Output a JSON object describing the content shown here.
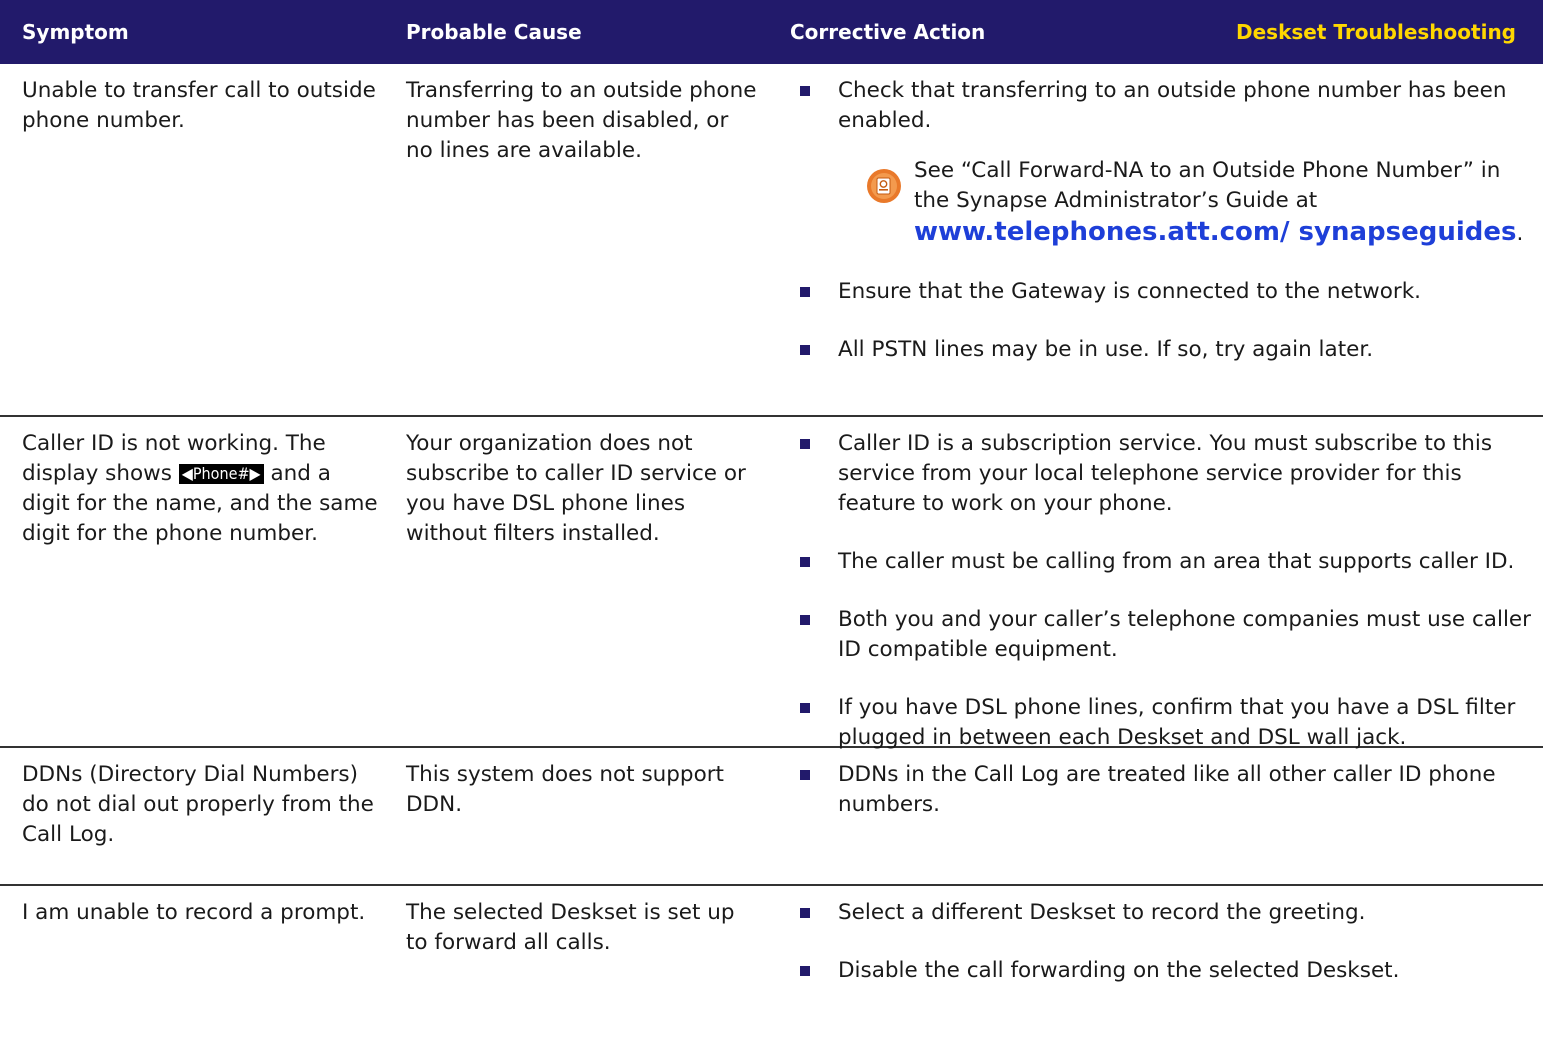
{
  "header": {
    "symptom": "Symptom",
    "cause": "Probable Cause",
    "action": "Corrective Action",
    "section_title": "Deskset Troubleshooting"
  },
  "rows": [
    {
      "symptom": "Unable to transfer call to outside phone number.",
      "cause": "Transferring to an outside phone number has been disabled, or no lines are available.",
      "actions": [
        "Check that transferring to an outside phone number has been enabled.",
        "Ensure that the Gateway is connected to the network.",
        "All PSTN lines may be in use. If so, try again later."
      ],
      "note": {
        "text": "See “Call Forward-NA to an Outside Phone Number” in the Synapse Administrator’s Guide at",
        "link": "www.telephones.att.com/ synapseguides",
        "end": "."
      }
    },
    {
      "symptom_before": "Caller ID is not working. The display shows",
      "softkey": "◀Phone#▶",
      "symptom_after": "and a digit for the name, and the same digit for the phone number.",
      "cause": "Your organization does not subscribe to caller ID service or you have DSL phone lines without filters installed.",
      "actions": [
        "Caller ID is a subscription service. You must subscribe to this service from your local telephone service provider for this feature to work on your phone.",
        "The caller must be calling from an area that supports caller ID.",
        "Both you and your caller’s telephone companies must use caller ID compatible equipment.",
        "If you have DSL phone lines, confirm that you have a DSL filter plugged in between each Deskset and DSL wall jack."
      ]
    },
    {
      "symptom": "DDNs (Directory Dial Numbers) do not dial out properly from the Call Log.",
      "cause": "This system does not support DDN.",
      "actions": [
        "DDNs in the Call Log are treated like all other caller ID phone numbers."
      ]
    },
    {
      "symptom": "I am unable to record a prompt.",
      "cause": "The selected Deskset is set up to forward all calls.",
      "actions": [
        "Select a different Deskset to record the greeting.",
        "Disable the call forwarding on the selected Deskset."
      ]
    }
  ],
  "colors": {
    "header_bg": "#221a6b",
    "header_title": "#ffd700",
    "link": "#1e3fd8",
    "bullet": "#221a6b"
  }
}
